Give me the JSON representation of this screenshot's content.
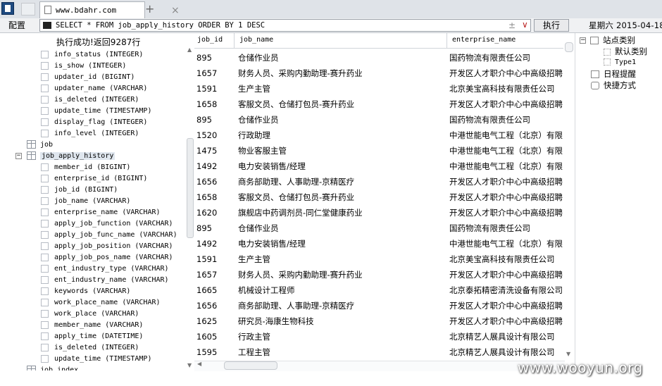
{
  "browser": {
    "tab_title": "www.bdahr.com",
    "tab_close": "×",
    "new_tab": "+"
  },
  "toolbar": {
    "config_label": "配置",
    "sql_query": "SELECT * FROM job_apply_history ORDER BY 1 DESC",
    "clear_glyph": "±",
    "dropdown_glyph": "∨",
    "run_label": "执行",
    "datetime": "星期六 2015-04-18"
  },
  "status_text": "执行成功!返回9287行",
  "tree": {
    "items": [
      {
        "label": "info_status (INTEGER)",
        "kind": "column"
      },
      {
        "label": "is_show (INTEGER)",
        "kind": "column"
      },
      {
        "label": "updater_id (BIGINT)",
        "kind": "column"
      },
      {
        "label": "updater_name (VARCHAR)",
        "kind": "column"
      },
      {
        "label": "is_deleted (INTEGER)",
        "kind": "column"
      },
      {
        "label": "update_time (TIMESTAMP)",
        "kind": "column"
      },
      {
        "label": "display_flag (INTEGER)",
        "kind": "column"
      },
      {
        "label": "info_level (INTEGER)",
        "kind": "column"
      },
      {
        "label": "job",
        "kind": "table"
      },
      {
        "label": "job_apply_history",
        "kind": "table-open"
      },
      {
        "label": "member_id (BIGINT)",
        "kind": "column"
      },
      {
        "label": "enterprise_id (BIGINT)",
        "kind": "column"
      },
      {
        "label": "job_id (BIGINT)",
        "kind": "column"
      },
      {
        "label": "job_name (VARCHAR)",
        "kind": "column"
      },
      {
        "label": "enterprise_name (VARCHAR)",
        "kind": "column"
      },
      {
        "label": "apply_job_function (VARCHAR)",
        "kind": "column"
      },
      {
        "label": "apply_job_func_name (VARCHAR)",
        "kind": "column"
      },
      {
        "label": "apply_job_position (VARCHAR)",
        "kind": "column"
      },
      {
        "label": "apply_job_pos_name (VARCHAR)",
        "kind": "column"
      },
      {
        "label": "ent_industry_type (VARCHAR)",
        "kind": "column"
      },
      {
        "label": "ent_industry_name (VARCHAR)",
        "kind": "column"
      },
      {
        "label": "keywords (VARCHAR)",
        "kind": "column"
      },
      {
        "label": "work_place_name (VARCHAR)",
        "kind": "column"
      },
      {
        "label": "work_place (VARCHAR)",
        "kind": "column"
      },
      {
        "label": "member_name (VARCHAR)",
        "kind": "column"
      },
      {
        "label": "apply_time (DATETIME)",
        "kind": "column"
      },
      {
        "label": "is_deleted (INTEGER)",
        "kind": "column"
      },
      {
        "label": "update_time (TIMESTAMP)",
        "kind": "column"
      },
      {
        "label": "job_index",
        "kind": "table-partial"
      }
    ],
    "expand_glyph": "−"
  },
  "grid": {
    "columns": [
      "job_id",
      "job_name",
      "enterprise_name"
    ],
    "rows": [
      [
        "895",
        "仓储作业员",
        "国药物流有限责任公司"
      ],
      [
        "1657",
        "财务人员、采购内勤助理-赛升药业",
        "开发区人才职介中心中高级招聘"
      ],
      [
        "1591",
        "生产主管",
        "北京美宝高科技有限责任公司"
      ],
      [
        "1658",
        "客服文员、仓储打包员-赛升药业",
        "开发区人才职介中心中高级招聘"
      ],
      [
        "895",
        "仓储作业员",
        "国药物流有限责任公司"
      ],
      [
        "1520",
        "行政助理",
        "中港世能电气工程（北京）有限"
      ],
      [
        "1475",
        "物业客服主管",
        "中港世能电气工程（北京）有限"
      ],
      [
        "1492",
        "电力安装销售/经理",
        "中港世能电气工程（北京）有限"
      ],
      [
        "1656",
        "商务部助理、人事助理-京精医疗",
        "开发区人才职介中心中高级招聘"
      ],
      [
        "1658",
        "客服文员、仓储打包员-赛升药业",
        "开发区人才职介中心中高级招聘"
      ],
      [
        "1620",
        "旗舰店中药调剂员-同仁堂健康药业",
        "开发区人才职介中心中高级招聘"
      ],
      [
        "895",
        "仓储作业员",
        "国药物流有限责任公司"
      ],
      [
        "1492",
        "电力安装销售/经理",
        "中港世能电气工程（北京）有限"
      ],
      [
        "1591",
        "生产主管",
        "北京美宝高科技有限责任公司"
      ],
      [
        "1657",
        "财务人员、采购内勤助理-赛升药业",
        "开发区人才职介中心中高级招聘"
      ],
      [
        "1665",
        "机械设计工程师",
        "北京泰拓精密清洗设备有限公司"
      ],
      [
        "1656",
        "商务部助理、人事助理-京精医疗",
        "开发区人才职介中心中高级招聘"
      ],
      [
        "1625",
        "研究员-海康生物科技",
        "开发区人才职介中心中高级招聘"
      ],
      [
        "1605",
        "行政主管",
        "北京精艺人展具设计有限公司"
      ],
      [
        "1595",
        "工程主管",
        "北京精艺人展具设计有限公司"
      ]
    ]
  },
  "right_panel": {
    "site_category": "站点类别",
    "default_category": "默认类别",
    "type1": "Type1",
    "reminders": "日程提醒",
    "shortcuts": "快捷方式",
    "expand_glyph": "−"
  },
  "watermark": "www.wooyun.org",
  "scroll_glyphs": {
    "up": "▲",
    "down": "▼",
    "left": "◀"
  }
}
